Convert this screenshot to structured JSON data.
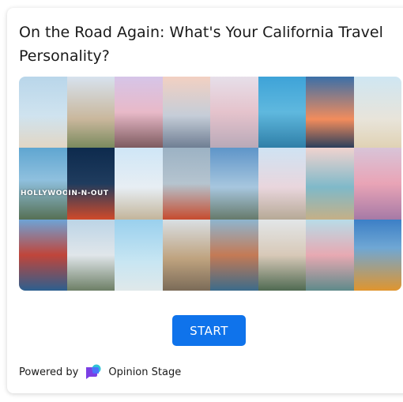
{
  "quiz": {
    "title": "On the Road Again: What's Your California Travel Personality?",
    "start_label": "START"
  },
  "footer": {
    "powered_by": "Powered by",
    "brand": "Opinion Stage"
  },
  "collage": {
    "tiles": [
      {
        "icon": "motel-sign-photo"
      },
      {
        "icon": "palace-rotunda-photo"
      },
      {
        "icon": "diner-photo"
      },
      {
        "icon": "city-skyline-photo"
      },
      {
        "icon": "castle-photo"
      },
      {
        "icon": "palm-trees-photo"
      },
      {
        "icon": "lifeguard-tower-sunset-photo"
      },
      {
        "icon": "lifeguard-tower-photo"
      },
      {
        "icon": "hollywood-sign-photo",
        "caption": "HOLLYWOOD"
      },
      {
        "icon": "in-n-out-sign-photo",
        "caption": "IN-N-OUT"
      },
      {
        "icon": "ferris-wheel-photo"
      },
      {
        "icon": "golden-gate-bridge-photo"
      },
      {
        "icon": "retro-sign-photo"
      },
      {
        "icon": "pastel-houses-photo"
      },
      {
        "icon": "coastline-photo"
      },
      {
        "icon": "neon-sign-photo"
      },
      {
        "icon": "bridge-tower-photo"
      },
      {
        "icon": "street-sign-photo"
      },
      {
        "icon": "beach-tower-photo"
      },
      {
        "icon": "cliff-stairs-photo"
      },
      {
        "icon": "coastal-cliffs-photo"
      },
      {
        "icon": "vintage-car-photo"
      },
      {
        "icon": "pink-building-photo"
      },
      {
        "icon": "poppies-field-photo"
      }
    ]
  },
  "colors": {
    "accent": "#0f73eb",
    "logo_purple": "#7b3fe4",
    "logo_teal": "#2ec4d6"
  }
}
